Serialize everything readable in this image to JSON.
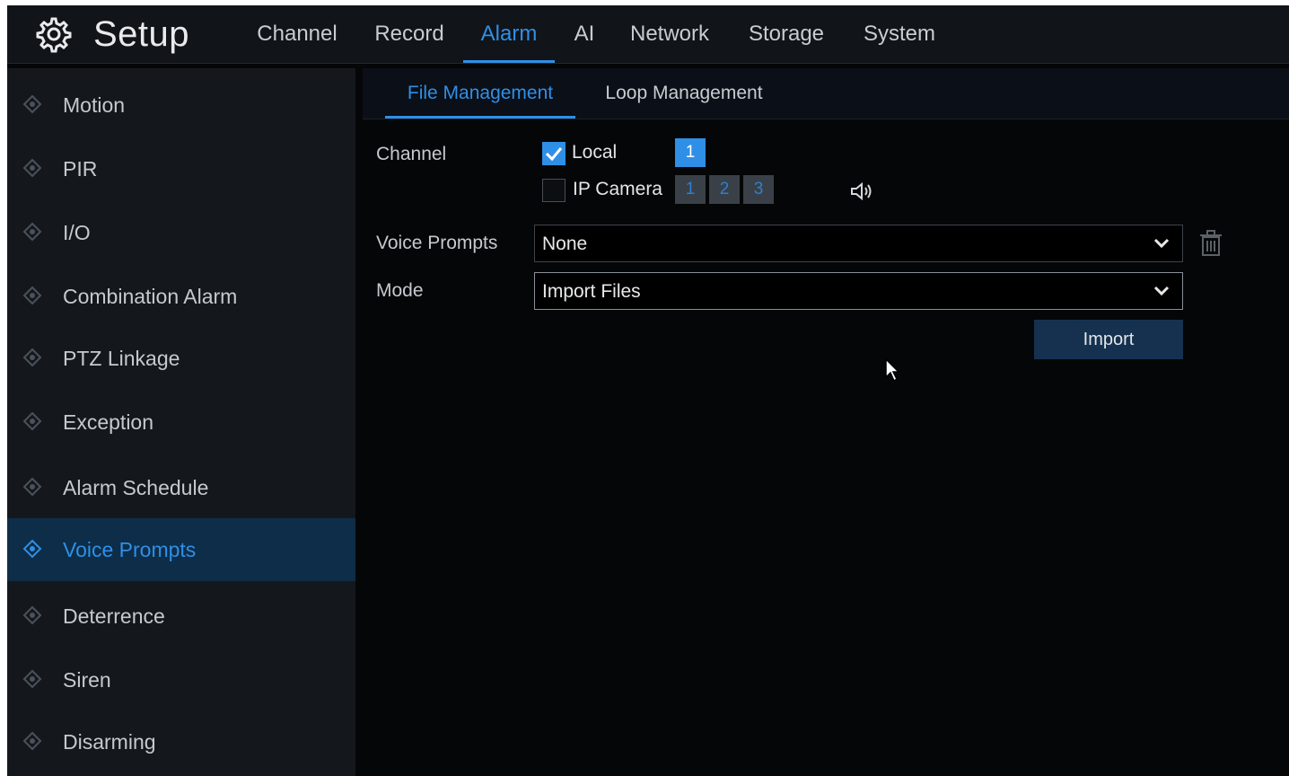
{
  "app": {
    "title": "Setup"
  },
  "topnav": {
    "tabs": [
      "Channel",
      "Record",
      "Alarm",
      "AI",
      "Network",
      "Storage",
      "System"
    ],
    "active": "Alarm"
  },
  "sidebar": {
    "items": [
      "Motion",
      "PIR",
      "I/O",
      "Combination Alarm",
      "PTZ Linkage",
      "Exception",
      "Alarm Schedule",
      "Voice Prompts",
      "Deterrence",
      "Siren",
      "Disarming"
    ],
    "active": "Voice Prompts"
  },
  "subtabs": {
    "tabs": [
      "File Management",
      "Loop Management"
    ],
    "active": "File Management"
  },
  "form": {
    "channel_label": "Channel",
    "local": {
      "label": "Local",
      "checked": true,
      "channels": [
        "1"
      ]
    },
    "ip_camera": {
      "label": "IP Camera",
      "checked": false,
      "channels": [
        "1",
        "2",
        "3"
      ]
    },
    "voice_prompts_label": "Voice Prompts",
    "voice_prompts_value": "None",
    "mode_label": "Mode",
    "mode_value": "Import Files",
    "import_label": "Import"
  },
  "icons": {
    "brand": "gear-icon",
    "sidebar_item": "diamond-dot-icon",
    "speaker": "speaker-icon",
    "delete": "trash-icon",
    "dropdown": "chevron-down-icon",
    "pointer": "mouse-cursor-icon"
  },
  "colors": {
    "accent": "#2f8fe6",
    "background": "#050607",
    "sidebar": "#14181d",
    "sidebar_active": "#0e2d48",
    "button": "#15314f"
  }
}
